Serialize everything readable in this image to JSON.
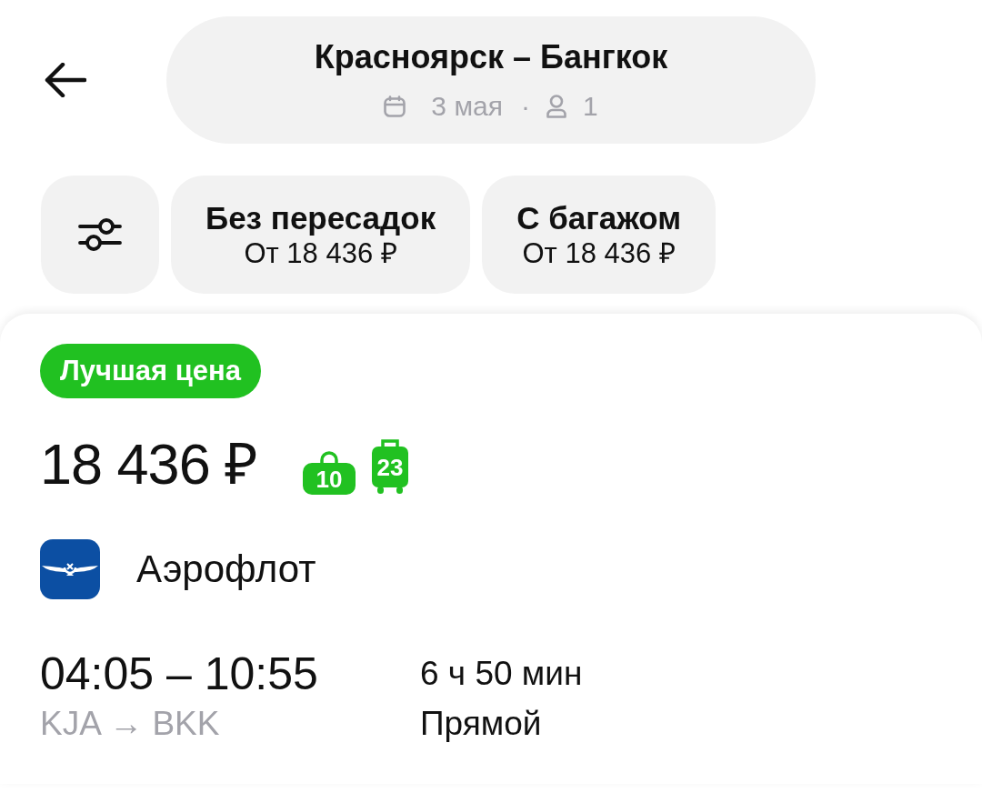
{
  "search": {
    "title": "Красноярск – Бангкок",
    "date": "3 мая",
    "separator": "·",
    "passengers": "1"
  },
  "filters": [
    {
      "kind": "settings"
    },
    {
      "kind": "chip",
      "title": "Без пересадок",
      "subtitle": "От 18 436 ₽",
      "selected": false
    },
    {
      "kind": "chip",
      "title": "С багажом",
      "subtitle": "От 18 436 ₽",
      "selected": false
    }
  ],
  "offer": {
    "badge": "Лучшая цена",
    "price": "18 436 ₽",
    "baggage": [
      {
        "kind": "hand",
        "weight": "10"
      },
      {
        "kind": "checked",
        "weight": "23"
      }
    ],
    "airline": "Аэрофлот",
    "times": "04:05 – 10:55",
    "route": "KJA → BKK",
    "duration": "6 ч 50 мин",
    "stops": "Прямой"
  }
}
